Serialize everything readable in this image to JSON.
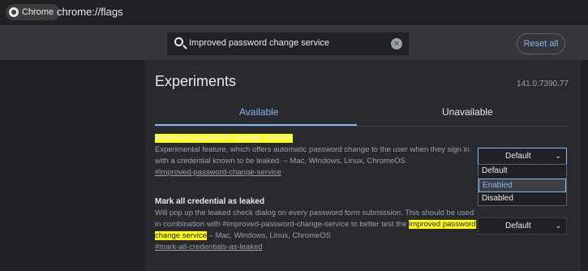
{
  "browser": {
    "tab_label": "Chrome",
    "url": "chrome://flags"
  },
  "header": {
    "search_value": "Improved password change service",
    "reset_label": "Reset all"
  },
  "page": {
    "title": "Experiments",
    "version": "141.0.7390.77",
    "tabs": [
      {
        "label": "Available",
        "active": true
      },
      {
        "label": "Unavailable",
        "active": false
      }
    ]
  },
  "experiments": [
    {
      "name": "Improved password change service",
      "description": "Experimental feature, which offers automatic password change to the user when they sign in with a credential known to be leaked. – Mac, Windows, Linux, ChromeOS",
      "link": "#improved-password-change-service",
      "select_value": "Default",
      "options": [
        "Default",
        "Enabled",
        "Disabled"
      ],
      "highlighted_option": "Enabled"
    },
    {
      "name": "Mark all credential as leaked",
      "desc_before": "Will pop up the leaked check dialog on every password form submission. This should be used in combination with #improved-password-change-service to better test the ",
      "desc_highlight": "improved password change service",
      "desc_after": " – Mac, Windows, Linux, ChromeOS",
      "link": "#mark-all-credentials-as-leaked",
      "select_value": "Default"
    }
  ],
  "colors": {
    "accent": "#8ab4f8",
    "highlight": "#ffff00",
    "background": "#202124",
    "panel": "#292a2d"
  }
}
